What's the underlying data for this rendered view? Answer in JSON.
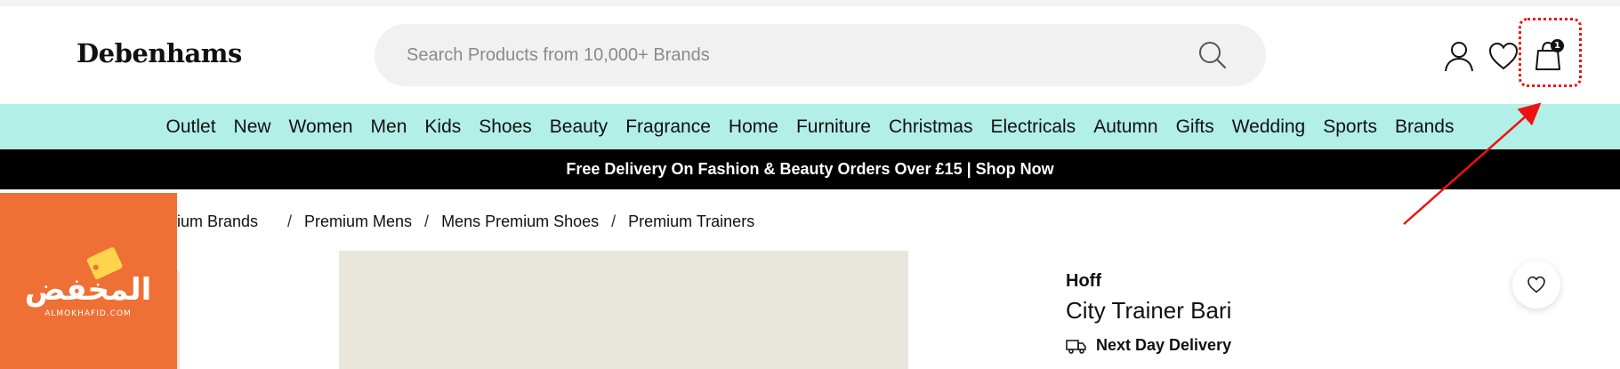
{
  "header": {
    "logo": "Debenhams",
    "search_placeholder": "Search Products from 10,000+ Brands",
    "icons": [
      "search-icon",
      "account-icon",
      "heart-icon",
      "shopping-bag-icon"
    ],
    "bag_count": "1"
  },
  "nav": {
    "items": [
      "Outlet",
      "New",
      "Women",
      "Men",
      "Kids",
      "Shoes",
      "Beauty",
      "Fragrance",
      "Home",
      "Furniture",
      "Christmas",
      "Electricals",
      "Autumn",
      "Gifts",
      "Wedding",
      "Sports",
      "Brands"
    ]
  },
  "promo": {
    "text": "Free Delivery On Fashion & Beauty Orders Over £15 | Shop Now"
  },
  "breadcrumb": {
    "items": [
      "mium Brands",
      "Premium Mens",
      "Mens Premium Shoes",
      "Premium Trainers"
    ],
    "separator": "/"
  },
  "product": {
    "brand": "Hoff",
    "name": "City Trainer Bari",
    "delivery": "Next Day Delivery"
  },
  "watermark": {
    "text_ar": "المخفض",
    "text_en": "ALMOKHAFID.COM"
  },
  "colors": {
    "nav_bg": "#b2efe6",
    "promo_bg": "#000000",
    "watermark_bg": "#ef7035",
    "highlight": "#e11111"
  }
}
